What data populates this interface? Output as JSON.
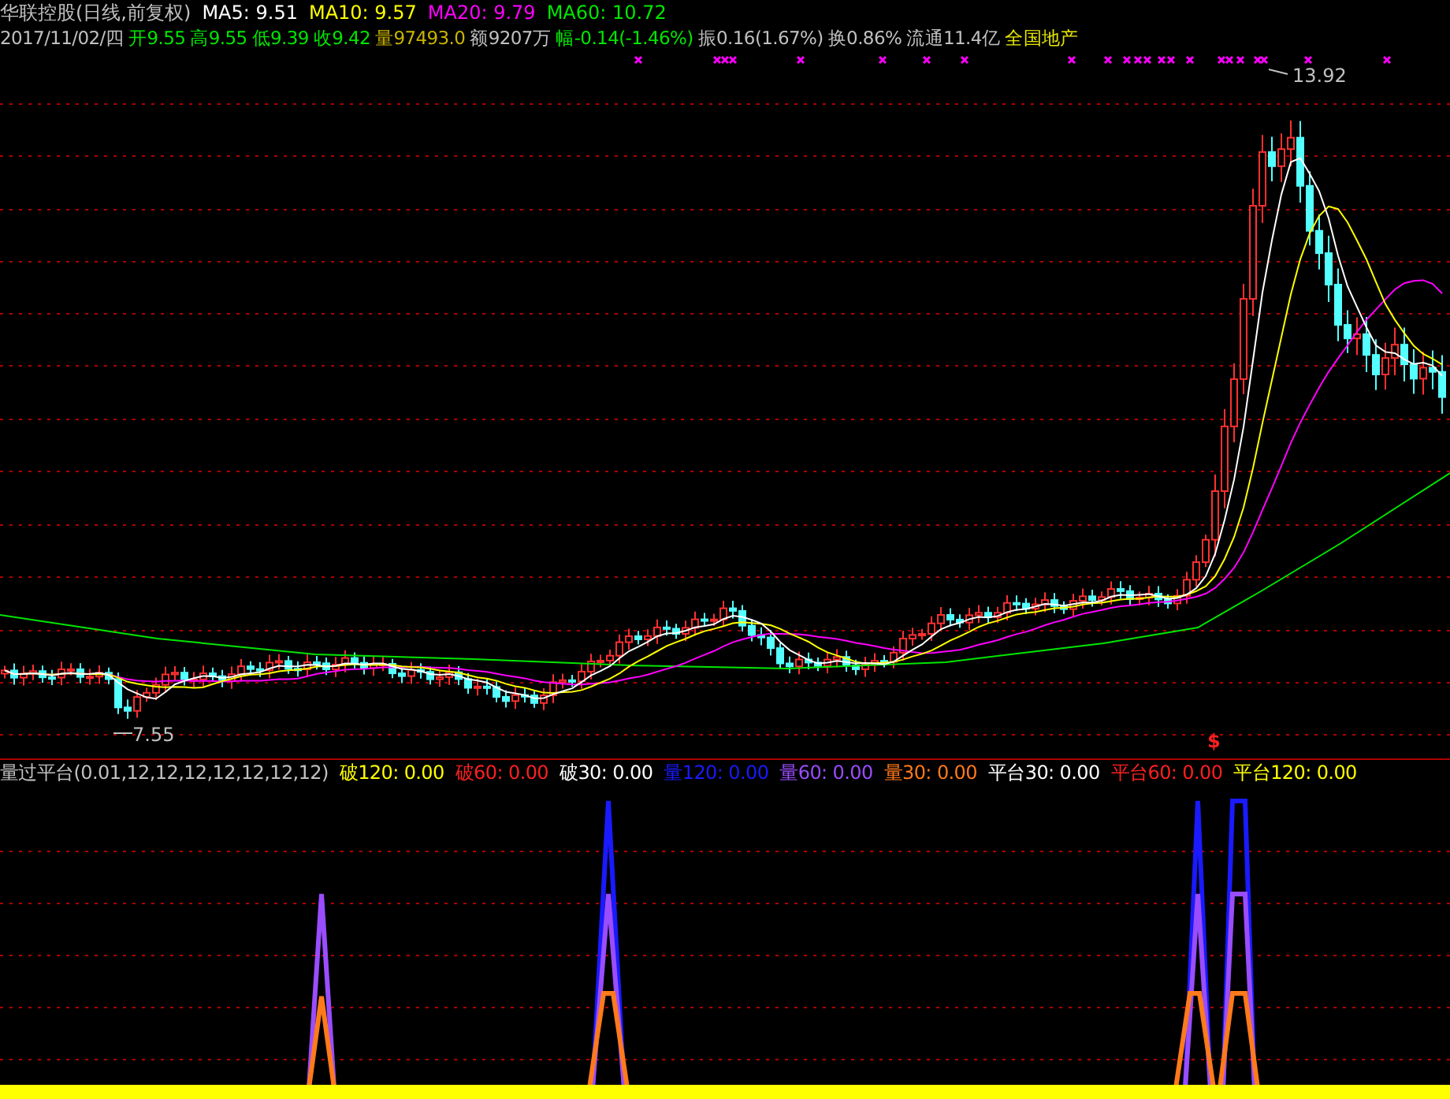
{
  "header": {
    "title": "华联控股(日线,前复权)",
    "ma": [
      {
        "label": "MA5: 9.51",
        "color": "#ffffff"
      },
      {
        "label": "MA10: 9.57",
        "color": "#ffff00"
      },
      {
        "label": "MA20: 9.79",
        "color": "#ff00ff"
      },
      {
        "label": "MA60: 10.72",
        "color": "#00e600"
      }
    ],
    "quote": [
      {
        "text": "2017/11/02/四",
        "color": "#c0c0c0"
      },
      {
        "text": "开9.55",
        "color": "#00e600"
      },
      {
        "text": "高9.55",
        "color": "#00e600"
      },
      {
        "text": "低9.39",
        "color": "#00e600"
      },
      {
        "text": "收9.42",
        "color": "#00e600"
      },
      {
        "text": "量97493.0",
        "color": "#c8b400"
      },
      {
        "text": "额9207万",
        "color": "#c0c0c0"
      },
      {
        "text": "幅-0.14(-1.46%)",
        "color": "#00e600"
      },
      {
        "text": "振0.16(1.67%)",
        "color": "#c0c0c0"
      },
      {
        "text": "换0.86%",
        "color": "#c0c0c0"
      },
      {
        "text": "流通11.4亿",
        "color": "#c0c0c0"
      },
      {
        "text": "全国地产",
        "color": "#e6e600"
      }
    ]
  },
  "price_chart": {
    "high_label": "13.92",
    "low_label": "7.55",
    "signal_mark": "$"
  },
  "indicator": {
    "title": "量过平台(0.01,12,12,12,12,12,12,12)",
    "values": [
      {
        "label": "破120: 0.00",
        "color": "#ffff00"
      },
      {
        "label": "破60: 0.00",
        "color": "#ff2020"
      },
      {
        "label": "破30: 0.00",
        "color": "#ffffff"
      },
      {
        "label": "量120: 0.00",
        "color": "#1a1aff"
      },
      {
        "label": "量60: 0.00",
        "color": "#9a4dff"
      },
      {
        "label": "量30: 0.00",
        "color": "#ff7a1a"
      },
      {
        "label": "平台30: 0.00",
        "color": "#ffffff"
      },
      {
        "label": "平台60: 0.00",
        "color": "#ff2020"
      },
      {
        "label": "平台120: 0.00",
        "color": "#ffff00"
      }
    ]
  }
}
